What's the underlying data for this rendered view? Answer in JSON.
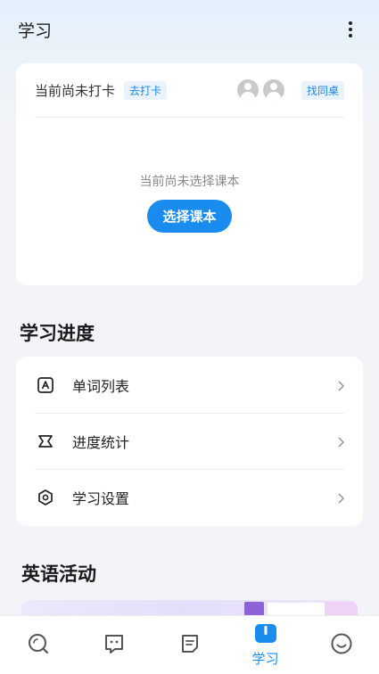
{
  "header": {
    "title": "学习",
    "more_icon": "more-vertical-icon"
  },
  "checkin": {
    "status": "当前尚未打卡",
    "checkin_button": "去打卡",
    "find_deskmate_button": "找同桌",
    "empty_text": "当前尚未选择课本",
    "select_book_button": "选择课本"
  },
  "progress": {
    "title": "学习进度",
    "items": [
      {
        "label": "单词列表",
        "icon": "word-list-icon"
      },
      {
        "label": "进度统计",
        "icon": "statistics-icon"
      },
      {
        "label": "学习设置",
        "icon": "settings-icon"
      }
    ]
  },
  "activities": {
    "title": "英语活动"
  },
  "tabbar": {
    "items": [
      {
        "icon": "search-icon",
        "label": ""
      },
      {
        "icon": "chat-icon",
        "label": ""
      },
      {
        "icon": "notes-icon",
        "label": ""
      },
      {
        "icon": "study-icon",
        "label": "学习",
        "active": true
      },
      {
        "icon": "smile-icon",
        "label": ""
      }
    ]
  },
  "colors": {
    "accent": "#1a8cf0",
    "pill_bg": "#eaf3fd"
  }
}
